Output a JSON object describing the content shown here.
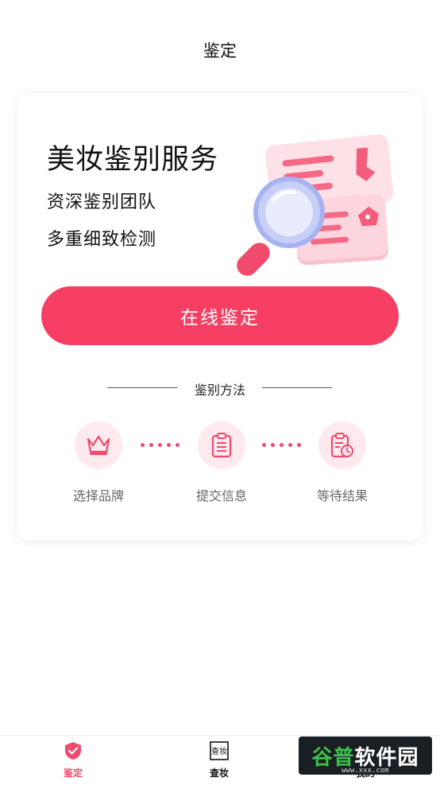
{
  "header": {
    "title": "鉴定"
  },
  "hero": {
    "title": "美妆鉴别服务",
    "line1": "资深鉴别团队",
    "line2": "多重细致检测"
  },
  "cta": {
    "label": "在线鉴定"
  },
  "method": {
    "title": "鉴别方法",
    "steps": [
      {
        "label": "选择品牌",
        "icon": "crown-icon"
      },
      {
        "label": "提交信息",
        "icon": "clipboard-list-icon"
      },
      {
        "label": "等待结果",
        "icon": "clipboard-clock-icon"
      }
    ]
  },
  "tabbar": {
    "items": [
      {
        "label": "鉴定",
        "icon": "shield-check-icon",
        "active": true
      },
      {
        "label": "查妆",
        "icon": "stamp-icon",
        "active": false
      },
      {
        "label": "我的",
        "icon": "user-icon",
        "active": false
      }
    ],
    "stamp_text": "查妆"
  },
  "watermark": {
    "green": "谷普",
    "white": "软件园",
    "url": "www.xxx.com"
  },
  "colors": {
    "accent": "#f63f63",
    "soft": "#fde9ee"
  }
}
